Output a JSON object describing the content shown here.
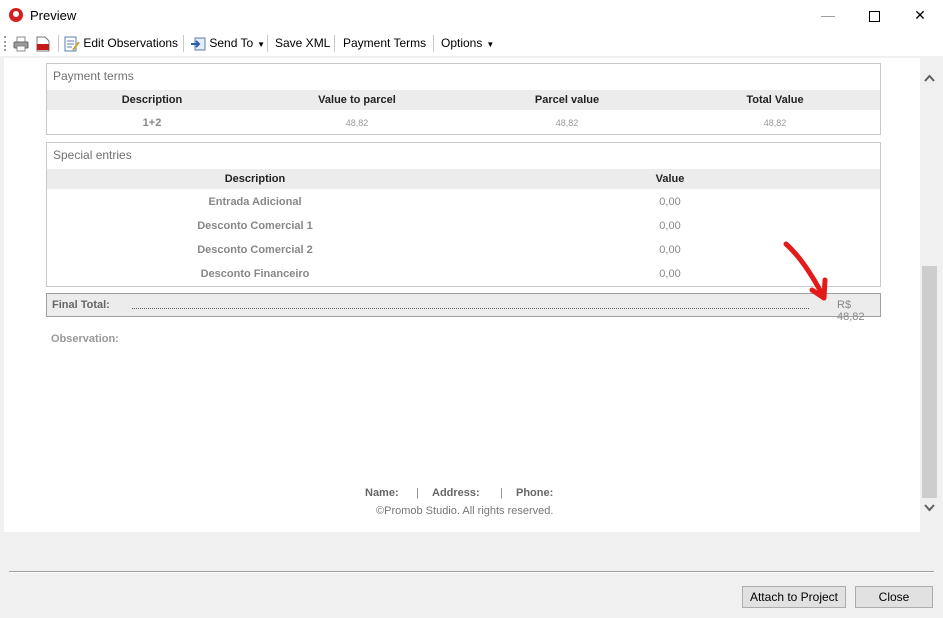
{
  "window": {
    "title": "Preview"
  },
  "toolbar": {
    "edit_observations": "Edit Observations",
    "send_to": "Send To",
    "save_xml": "Save XML",
    "payment_terms": "Payment Terms",
    "options": "Options"
  },
  "payment_terms": {
    "title": "Payment terms",
    "headers": [
      "Description",
      "Value to parcel",
      "Parcel value",
      "Total Value"
    ],
    "rows": [
      {
        "description": "1+2",
        "value_to_parcel": "48,82",
        "parcel_value": "48,82",
        "total_value": "48,82"
      }
    ]
  },
  "special_entries": {
    "title": "Special entries",
    "headers": [
      "Description",
      "Value"
    ],
    "rows": [
      {
        "description": "Entrada Adicional",
        "value": "0,00"
      },
      {
        "description": "Desconto Comercial 1",
        "value": "0,00"
      },
      {
        "description": "Desconto Comercial 2",
        "value": "0,00"
      },
      {
        "description": "Desconto Financeiro",
        "value": "0,00"
      }
    ]
  },
  "final_total": {
    "label": "Final Total:",
    "value": "R$ 48,82"
  },
  "observation": {
    "label": "Observation:"
  },
  "footer": {
    "name_label": "Name:",
    "address_label": "Address:",
    "phone_label": "Phone:",
    "separator": "|",
    "copyright": "©Promob Studio. All rights reserved."
  },
  "buttons": {
    "attach": "Attach to Project",
    "close": "Close"
  },
  "colors": {
    "arrow": "#e31b1b",
    "app_icon": "#d81e1e"
  }
}
